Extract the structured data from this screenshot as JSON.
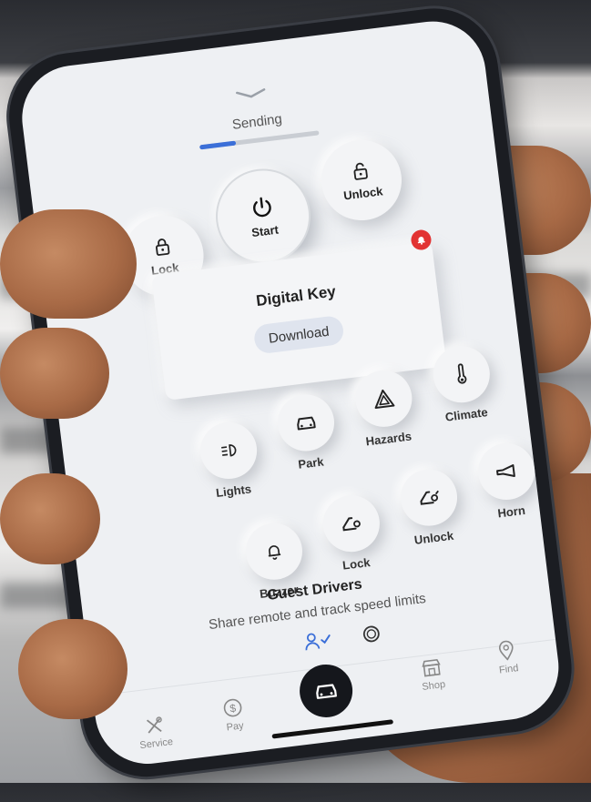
{
  "status": {
    "text": "Sending",
    "progress": 0.3
  },
  "primary_actions": {
    "lock_label": "Lock",
    "start_label": "Start",
    "unlock_label": "Unlock"
  },
  "digital_key": {
    "title": "Digital Key",
    "download_label": "Download",
    "alert_icon": "bell-alert-icon"
  },
  "controls": {
    "lights": "Lights",
    "park": "Park",
    "hazards": "Hazards",
    "climate": "Climate",
    "buzzer": "Buzzer",
    "lock": "Lock",
    "unlock": "Unlock",
    "horn": "Horn"
  },
  "guest_drivers": {
    "title": "Guest Drivers",
    "subtitle": "Share remote and track speed limits"
  },
  "tabbar": {
    "service": "Service",
    "pay": "Pay",
    "shop": "Shop",
    "find": "Find"
  },
  "colors": {
    "accent": "#3b6fd8",
    "alert": "#e23333",
    "fab": "#15171c"
  }
}
